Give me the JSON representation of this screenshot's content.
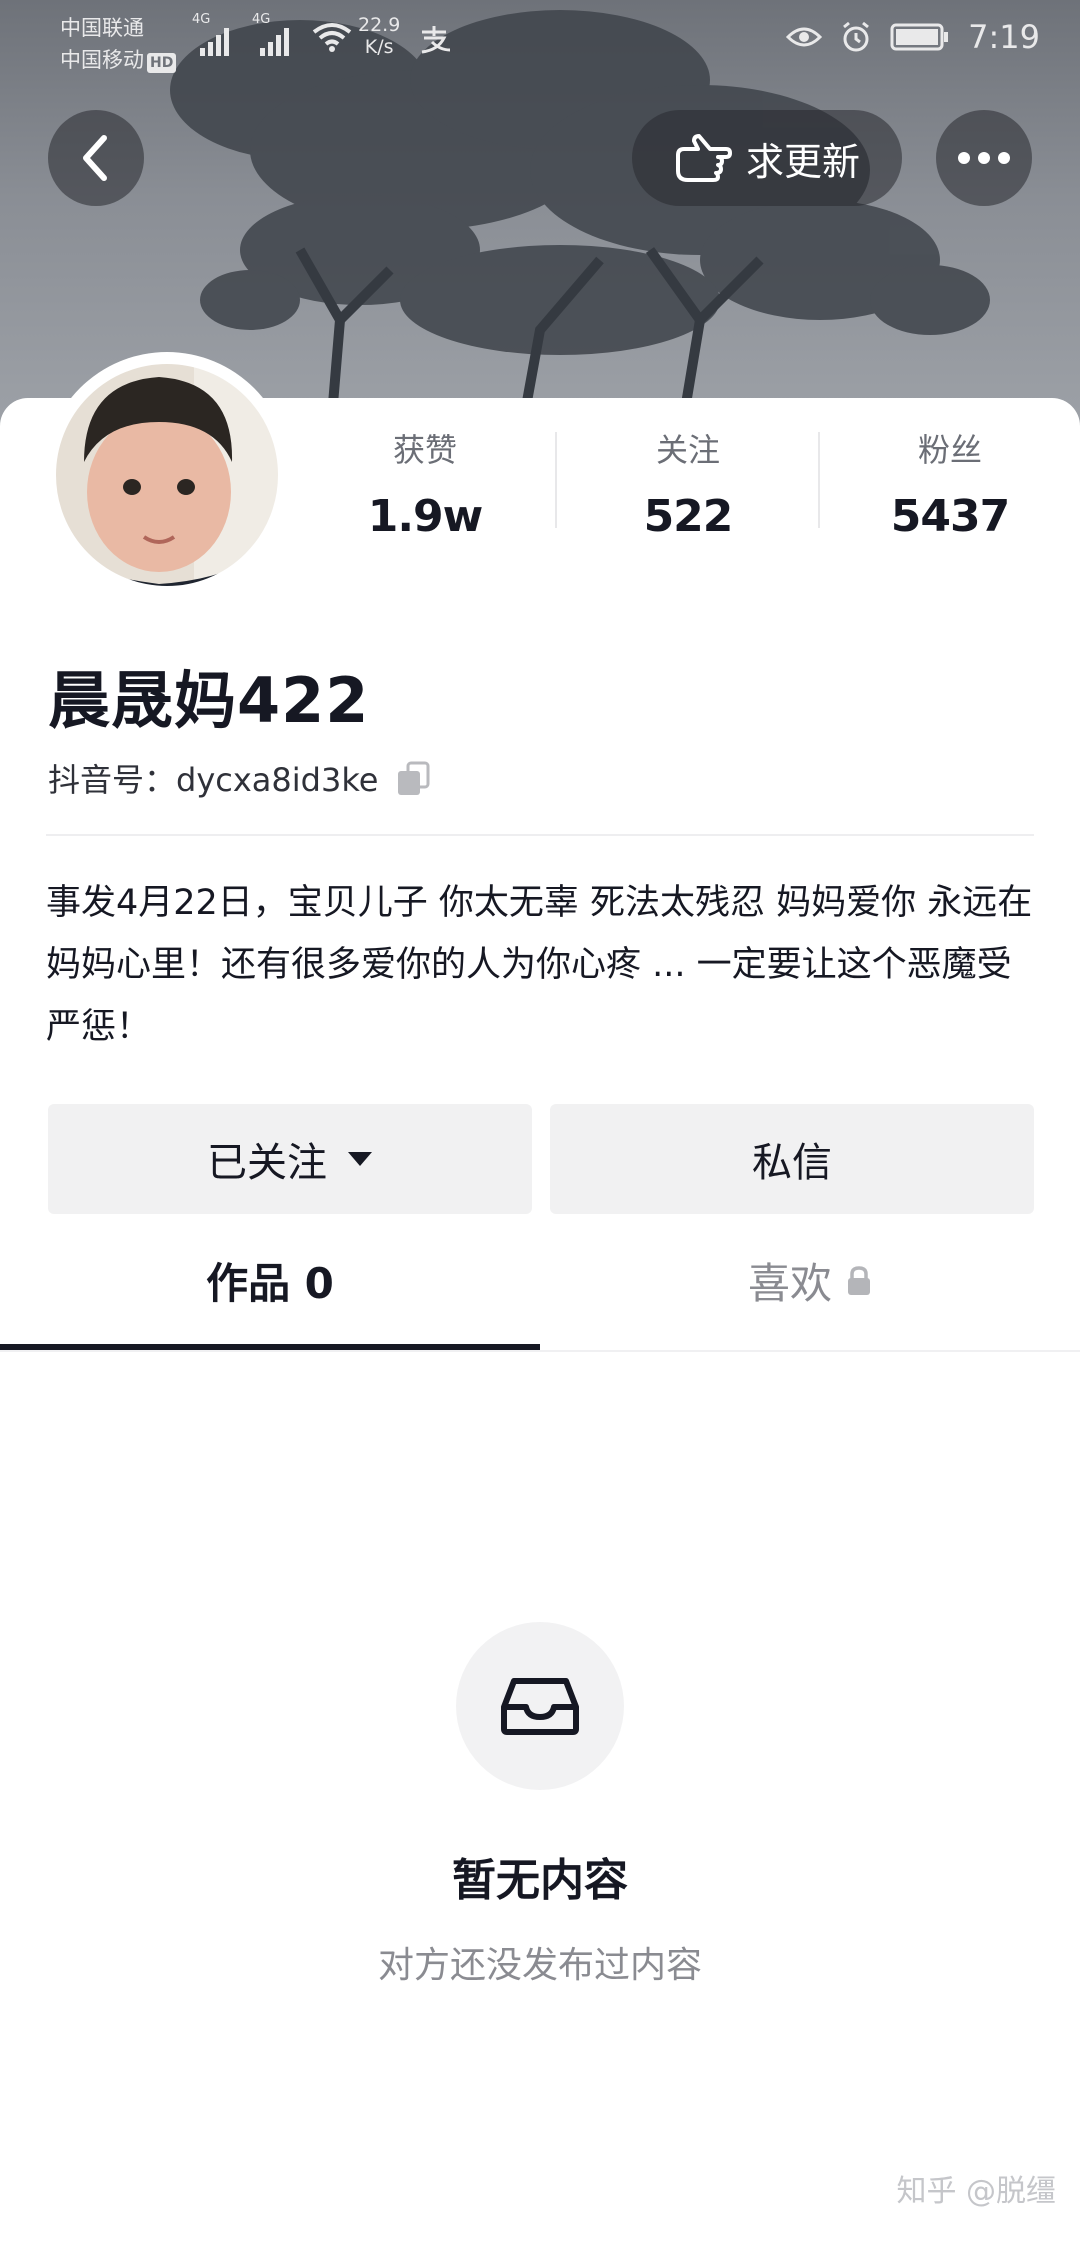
{
  "status_bar": {
    "carrier_1": "中国联通",
    "carrier_2": "中国移动",
    "hd_badge": "HD",
    "net_1": "4G",
    "net_2": "4G",
    "speed_value": "22.9",
    "speed_unit": "K/s",
    "time": "7:19"
  },
  "header": {
    "update_label": "求更新"
  },
  "profile": {
    "stats": [
      {
        "label": "获赞",
        "value": "1.9w"
      },
      {
        "label": "关注",
        "value": "522"
      },
      {
        "label": "粉丝",
        "value": "5437"
      }
    ],
    "name": "晨晟妈422",
    "uid_label": "抖音号：",
    "uid_value": "dycxa8id3ke",
    "bio": "事发4月22日，宝贝儿子 你太无辜 死法太残忍 妈妈爱你 永远在妈妈心里！还有很多爱你的人为你心疼 ... 一定要让这个恶魔受严惩！"
  },
  "actions": {
    "follow_label": "已关注",
    "message_label": "私信"
  },
  "tabs": {
    "works_label": "作品 0",
    "likes_label": "喜欢"
  },
  "empty_state": {
    "title": "暂无内容",
    "subtitle": "对方还没发布过内容"
  },
  "watermark": "知乎 @脱缰"
}
